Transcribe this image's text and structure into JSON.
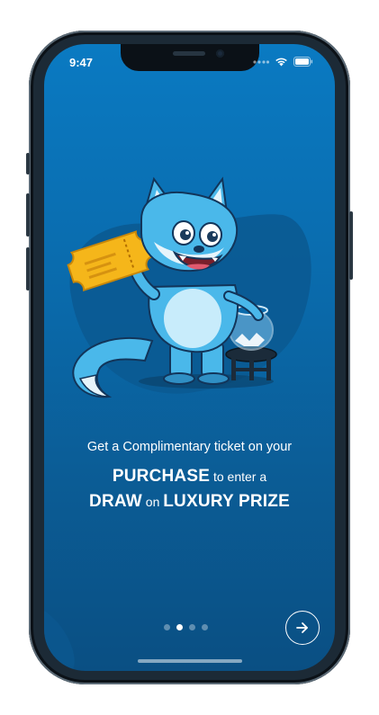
{
  "status_bar": {
    "time": "9:47",
    "icons": [
      "cellular-dots-icon",
      "wifi-icon",
      "battery-icon"
    ]
  },
  "onboarding": {
    "line1": "Get a Complimentary ticket on your",
    "line2_strong": "PURCHASE",
    "line2_rest": "to enter a",
    "line3_strong1": "DRAW",
    "line3_mid": "on",
    "line3_strong2": "LUXURY PRIZE"
  },
  "pagination": {
    "total": 4,
    "active_index": 1
  },
  "next_button": {
    "icon": "arrow-right-icon"
  },
  "colors": {
    "background_top": "#0a7ac2",
    "background_bottom": "#0a4f83",
    "mascot_blue": "#4ab8ea",
    "ticket_yellow": "#f5b61a"
  }
}
